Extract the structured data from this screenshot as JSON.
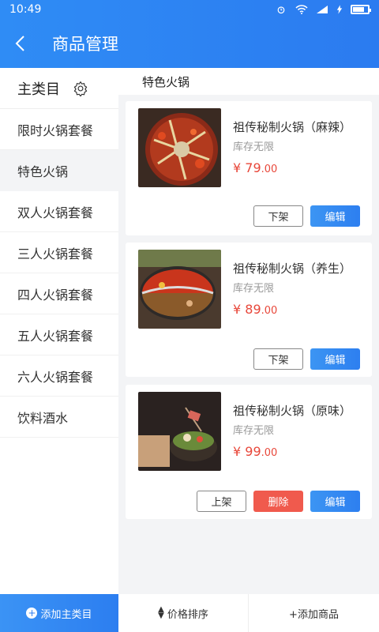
{
  "status_bar": {
    "time": "10:49",
    "icons": [
      "alarm-icon",
      "wifi-icon",
      "signal-icon",
      "charging-icon",
      "battery-icon"
    ]
  },
  "app_bar": {
    "title": "商品管理",
    "back_icon": "chevron-left-icon"
  },
  "sidebar": {
    "header": "主类目",
    "settings_icon": "gear-icon",
    "items": [
      {
        "label": "限时火锅套餐"
      },
      {
        "label": "特色火锅",
        "active": true
      },
      {
        "label": "双人火锅套餐"
      },
      {
        "label": "三人火锅套餐"
      },
      {
        "label": "四人火锅套餐"
      },
      {
        "label": "五人火锅套餐"
      },
      {
        "label": "六人火锅套餐"
      },
      {
        "label": "饮料酒水"
      }
    ]
  },
  "content": {
    "section_title": "特色火锅",
    "products": [
      {
        "name": "祖传秘制火锅（麻辣）",
        "stock": "库存无限",
        "price_symbol": "¥",
        "price_int": "79",
        "price_dec": ".00",
        "buttons": [
          "下架",
          "编辑"
        ]
      },
      {
        "name": "祖传秘制火锅（养生）",
        "stock": "库存无限",
        "price_symbol": "¥",
        "price_int": "89",
        "price_dec": ".00",
        "buttons": [
          "下架",
          "编辑"
        ]
      },
      {
        "name": "祖传秘制火锅（原味）",
        "stock": "库存无限",
        "price_symbol": "¥",
        "price_int": "99",
        "price_dec": ".00",
        "buttons": [
          "上架",
          "删除",
          "编辑"
        ]
      }
    ]
  },
  "bottom_bar": {
    "add_category": "添加主类目",
    "sort_price": "价格排序",
    "add_product": "+添加商品"
  },
  "colors": {
    "primary": "#2b7bf0",
    "price": "#e8473a",
    "danger": "#f05a4d"
  }
}
